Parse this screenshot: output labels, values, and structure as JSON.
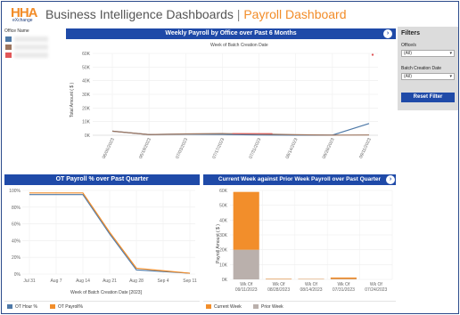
{
  "header": {
    "logo_text": "HHA",
    "logo_sub": "eXchange",
    "title_main": "Business Intelligence Dashboards",
    "title_sep": "|",
    "title_accent": "Payroll Dashboard"
  },
  "office_panel": {
    "label": "Office Name",
    "swatches": [
      "#4e79a7",
      "#9c755f",
      "#e15759"
    ]
  },
  "filters": {
    "title": "Filters",
    "office_label": "Office/s",
    "office_value": "(All)",
    "date_label": "Batch Creation Date",
    "date_value": "(All)",
    "reset_label": "Reset Filter"
  },
  "colors": {
    "header_blue": "#1f4aa8",
    "accent_orange": "#f28c28",
    "ot_hour": "#4e79a7",
    "ot_payroll": "#f28e2b",
    "current_week": "#f28e2b",
    "prior_week": "#bab0ac"
  },
  "chart_data": [
    {
      "type": "line",
      "title": "Weekly Payroll by Office over Past 6 Months",
      "subtitle": "Week of Batch Creation Date",
      "xlabel": "",
      "ylabel": "Total Amount ( $ )",
      "categories": [
        "06/05/2023",
        "06/19/2023",
        "07/03/2023",
        "07/17/2023",
        "07/31/2023",
        "08/14/2023",
        "08/28/2023",
        "09/11/2023"
      ],
      "yticks": [
        "0K",
        "10K",
        "20K",
        "30K",
        "40K",
        "50K",
        "60K"
      ],
      "ylim": [
        0,
        60000
      ],
      "grid": true,
      "series": [
        {
          "color": "#4e79a7",
          "values": [
            3000,
            500,
            800,
            600,
            200,
            100,
            100,
            8600
          ]
        },
        {
          "color": "#9c755f",
          "values": [
            3000,
            500,
            1000,
            1200,
            900,
            400,
            100,
            200
          ]
        },
        {
          "color": "#e15759",
          "values": [
            null,
            null,
            null,
            null,
            1200,
            null,
            null,
            59000
          ]
        }
      ]
    },
    {
      "type": "line",
      "title": "OT Payroll % over Past Quarter",
      "xlabel": "Week of Batch Creation Date [2023]",
      "ylabel": "",
      "categories": [
        "Jul 31",
        "Aug 7",
        "Aug 14",
        "Aug 21",
        "Aug 28",
        "Sep 4",
        "Sep 11"
      ],
      "yticks": [
        "0%",
        "20%",
        "40%",
        "60%",
        "80%",
        "100%"
      ],
      "ylim": [
        0,
        100
      ],
      "grid": true,
      "legend": "bottom",
      "series": [
        {
          "name": "OT Hour %",
          "color": "#4e79a7",
          "values": [
            95,
            95,
            95,
            48,
            5,
            3,
            1
          ]
        },
        {
          "name": "OT Payroll%",
          "color": "#f28e2b",
          "values": [
            97,
            97,
            97,
            50,
            7,
            4,
            1
          ]
        }
      ]
    },
    {
      "type": "bar",
      "title": "Current Week against Prior Week Payroll over Past Quarter",
      "xlabel": "",
      "ylabel": "Payroll Amount ( $ )",
      "categories": [
        [
          "Wk Of",
          "09/11/2023"
        ],
        [
          "Wk Of",
          "08/28/2023"
        ],
        [
          "Wk Of",
          "08/14/2023"
        ],
        [
          "Wk Of",
          "07/31/2023"
        ],
        [
          "Wk Of",
          "07/24/2023"
        ]
      ],
      "yticks": [
        "0K",
        "10K",
        "20K",
        "30K",
        "40K",
        "50K",
        "60K"
      ],
      "ylim": [
        0,
        60000
      ],
      "stacked": true,
      "legend": "bottom",
      "series": [
        {
          "name": "Current Week",
          "color": "#f28e2b",
          "values": [
            39000,
            300,
            200,
            1000,
            0
          ]
        },
        {
          "name": "Prior Week",
          "color": "#bab0ac",
          "values": [
            20000,
            200,
            200,
            300,
            0
          ]
        }
      ]
    }
  ]
}
